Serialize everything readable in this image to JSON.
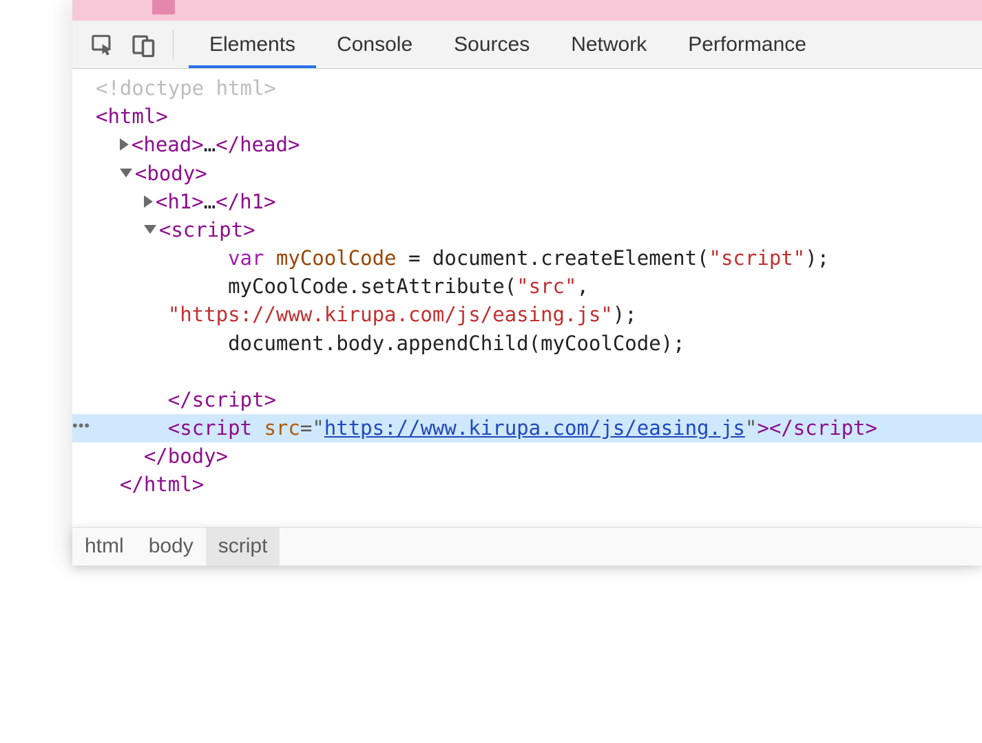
{
  "tabs": {
    "elements": "Elements",
    "console": "Console",
    "sources": "Sources",
    "network": "Network",
    "performance": "Performance"
  },
  "dom": {
    "doctype": "<!doctype html>",
    "html_open_l": "<",
    "html_open_t": "html",
    "html_open_r": ">",
    "head_open_l": "<",
    "head_open_t": "head",
    "head_open_r": ">",
    "ellipsis": "…",
    "head_close_l": "</",
    "head_close_t": "head",
    "head_close_r": ">",
    "body_open_l": "<",
    "body_open_t": "body",
    "body_open_r": ">",
    "h1_open_l": "<",
    "h1_open_t": "h1",
    "h1_open_r": ">",
    "h1_close_l": "</",
    "h1_close_t": "h1",
    "h1_close_r": ">",
    "script_open_l": "<",
    "script_open_t": "script",
    "script_open_r": ">",
    "code_line1_var": "var",
    "code_line1_id": " myCoolCode",
    "code_line1_eq": " = ",
    "code_line1_doc": "document",
    "code_line1_dot1": ".",
    "code_line1_fn": "createElement",
    "code_line1_p1": "(",
    "code_line1_str": "\"script\"",
    "code_line1_p2": ");",
    "code_line2_id": "myCoolCode",
    "code_line2_dot": ".",
    "code_line2_fn": "setAttribute",
    "code_line2_p1": "(",
    "code_line2_str": "\"src\"",
    "code_line2_comma": ",",
    "code_line3_str": "\"https://www.kirupa.com/js/easing.js\"",
    "code_line3_p": ");",
    "code_line4_doc": "document",
    "code_line4_d1": ".",
    "code_line4_body": "body",
    "code_line4_d2": ".",
    "code_line4_fn": "appendChild",
    "code_line4_p1": "(",
    "code_line4_arg": "myCoolCode",
    "code_line4_p2": ");",
    "script_close_l": "</",
    "script_close_t": "script",
    "script_close_r": ">",
    "sel_dots": "•••",
    "sel_open_l": "<",
    "sel_open_t": "script",
    "sel_attr_name": "src",
    "sel_attr_eq": "=",
    "sel_attr_q": "\"",
    "sel_attr_val": "https://www.kirupa.com/js/easing.js",
    "sel_open_r": ">",
    "sel_close_l": "</",
    "sel_close_t": "script",
    "sel_close_r": ">",
    "body_close_l": "</",
    "body_close_t": "body",
    "body_close_r": ">",
    "html_close_l": "</",
    "html_close_t": "html",
    "html_close_r": ">"
  },
  "breadcrumb": {
    "html": "html",
    "body": "body",
    "script": "script"
  }
}
